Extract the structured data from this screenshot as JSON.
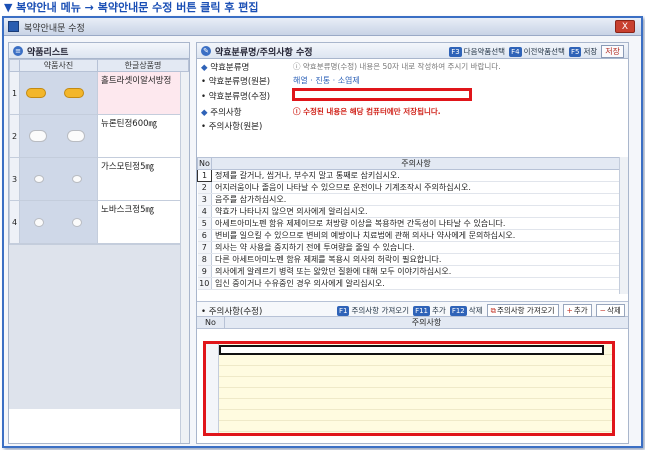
{
  "caption": "▼ 복약안내 메뉴 → 복약안내문 수정 버튼 클릭 후 편집",
  "window": {
    "title": "복약안내문 수정",
    "close_label": "X"
  },
  "left_panel": {
    "title": "약품리스트",
    "columns": [
      "약품사진",
      "한글상품명"
    ],
    "rows": [
      {
        "no": "1",
        "name": "홀트라셋이알서방정",
        "pill": "yellow"
      },
      {
        "no": "2",
        "name": "뉴론틴정600㎎",
        "pill": "white-oval"
      },
      {
        "no": "3",
        "name": "가스모틴정5㎎",
        "pill": "white-small"
      },
      {
        "no": "4",
        "name": "노바스크정5㎎",
        "pill": "white-round"
      }
    ]
  },
  "right_panel": {
    "title": "약효분류명/주의사항 수정",
    "hotkeys": [
      {
        "key": "F3",
        "label": "다음약품선택"
      },
      {
        "key": "F4",
        "label": "이전약품선택"
      },
      {
        "key": "F5",
        "label": "저장"
      }
    ],
    "save_label": "저장",
    "fields": {
      "efficacy_label": "약효분류명",
      "efficacy_hint": "약효분류명(수정) 내용은 50자 내로 작성하여 주시기 바랍니다.",
      "efficacy_orig_label": "약효분류명(원본)",
      "efficacy_orig_value": "해열 · 진통 · 소염제",
      "efficacy_edit_label": "약효분류명(수정)",
      "efficacy_edit_value": "",
      "caution_label": "주의사항",
      "caution_hint": "수정된 내용은 해당 컴퓨터에만 저장됩니다.",
      "caution_orig_label": "주의사항(원본)"
    },
    "notes_columns": [
      "No",
      "주의사항"
    ],
    "notes": [
      {
        "no": "1",
        "text": "정제를 갈거나, 씹거나, 부수지 말고 통째로 삼키십시오."
      },
      {
        "no": "2",
        "text": "어지러움이나 졸음이 나타날 수 있으므로 운전이나 기계조작시 주의하십시오."
      },
      {
        "no": "3",
        "text": "음주를 삼가하십시오."
      },
      {
        "no": "4",
        "text": "약효가 나타나지 않으면 의사에게 알리십시오."
      },
      {
        "no": "5",
        "text": "아세트아미노펜 함유 제제이므로 처방량 이상을 복용하면 간독성이 나타날 수 있습니다."
      },
      {
        "no": "6",
        "text": "변비를 일으킬 수 있으므로 변비의 예방이나 치료법에 관해 의사나 약사에게 문의하십시오."
      },
      {
        "no": "7",
        "text": "의사는 약 사용을 중지하기 전에 투여량을 줄일 수 있습니다."
      },
      {
        "no": "8",
        "text": "다른 아세트아미노펜 함유 제제를 복용시 의사의 허락이 필요합니다."
      },
      {
        "no": "9",
        "text": "의사에게 알레르기 병력 또는 앓았던 질환에 대해 모두 이야기하십시오."
      },
      {
        "no": "10",
        "text": "임신 중이거나 수유중인 경우 의사에게 알리십시오."
      }
    ],
    "edit": {
      "label": "주의사항(수정)",
      "hotkeys": [
        {
          "key": "F1",
          "label": "주의사항 가져오기"
        },
        {
          "key": "F11",
          "label": "추가"
        },
        {
          "key": "F12",
          "label": "삭제"
        }
      ],
      "import_button": "주의사항 가져오기",
      "add_button": "추가",
      "delete_button": "삭제",
      "columns": [
        "No",
        "주의사항"
      ]
    }
  }
}
